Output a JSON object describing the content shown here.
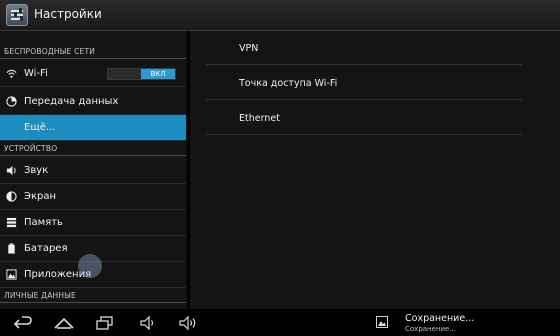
{
  "actionbar": {
    "title": "Настройки"
  },
  "sections": {
    "wireless": "БЕСПРОВОДНЫЕ СЕТИ",
    "device": "УСТРОЙСТВО",
    "personal": "ЛИЧНЫЕ ДАННЫЕ"
  },
  "left_items": {
    "wifi": {
      "label": "Wi-Fi",
      "toggle": "ВКЛ"
    },
    "data": {
      "label": "Передача данных"
    },
    "more": {
      "label": "Ещё..."
    },
    "sound": {
      "label": "Звук"
    },
    "display": {
      "label": "Экран"
    },
    "storage": {
      "label": "Память"
    },
    "battery": {
      "label": "Батарея"
    },
    "apps": {
      "label": "Приложения"
    }
  },
  "right_items": [
    "VPN",
    "Точка доступа Wi-Fi",
    "Ethernet"
  ],
  "notification": {
    "title": "Сохранение...",
    "subtitle": "Сохранение..."
  },
  "colors": {
    "accent": "#1c8dbf",
    "toggle_on": "#2c9ad6"
  }
}
